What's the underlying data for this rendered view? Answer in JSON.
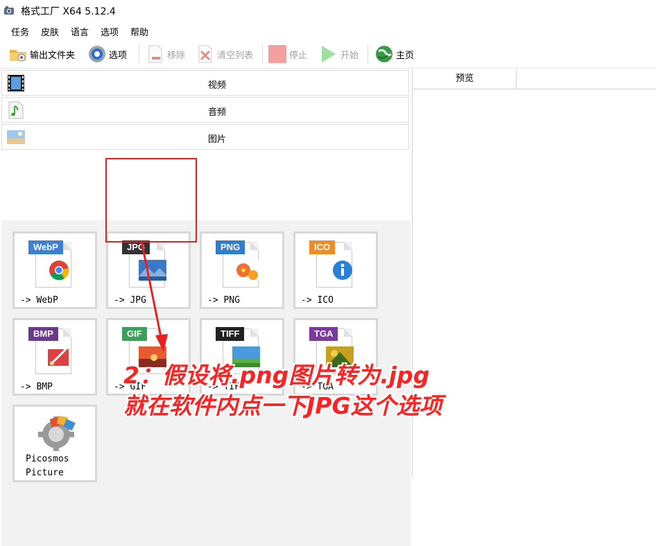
{
  "window": {
    "title": "格式工厂 X64 5.12.4"
  },
  "menu": [
    "任务",
    "皮肤",
    "语言",
    "选项",
    "帮助"
  ],
  "toolbar": {
    "output_folder": "输出文件夹",
    "options": "选项",
    "remove": "移除",
    "clear_list": "清空列表",
    "stop": "停止",
    "start": "开始",
    "home": "主页"
  },
  "categories": {
    "video": "视频",
    "audio": "音频",
    "image": "图片"
  },
  "tiles": [
    {
      "badge": "WebP",
      "label": "-> WebP",
      "color": "#3b7fd6"
    },
    {
      "badge": "JPG",
      "label": "-> JPG",
      "color": "#333333"
    },
    {
      "badge": "PNG",
      "label": "-> PNG",
      "color": "#2e7fd0"
    },
    {
      "badge": "ICO",
      "label": "-> ICO",
      "color": "#f08c28"
    },
    {
      "badge": "BMP",
      "label": "-> BMP",
      "color": "#6a3a8c"
    },
    {
      "badge": "GIF",
      "label": "-> GIF",
      "color": "#3aa05a"
    },
    {
      "badge": "TIFF",
      "label": "-> TIF",
      "color": "#222222"
    },
    {
      "badge": "TGA",
      "label": "-> TGA",
      "color": "#7a3a9a"
    }
  ],
  "picosmos": {
    "line1": "Picosmos",
    "line2": "Picture"
  },
  "preview": {
    "header": "预览"
  },
  "annotation": {
    "line1": "2：假设将.png图片转为.jpg",
    "line2": "就在软件内点一下JPG这个选项",
    "color": "#ff2222"
  }
}
